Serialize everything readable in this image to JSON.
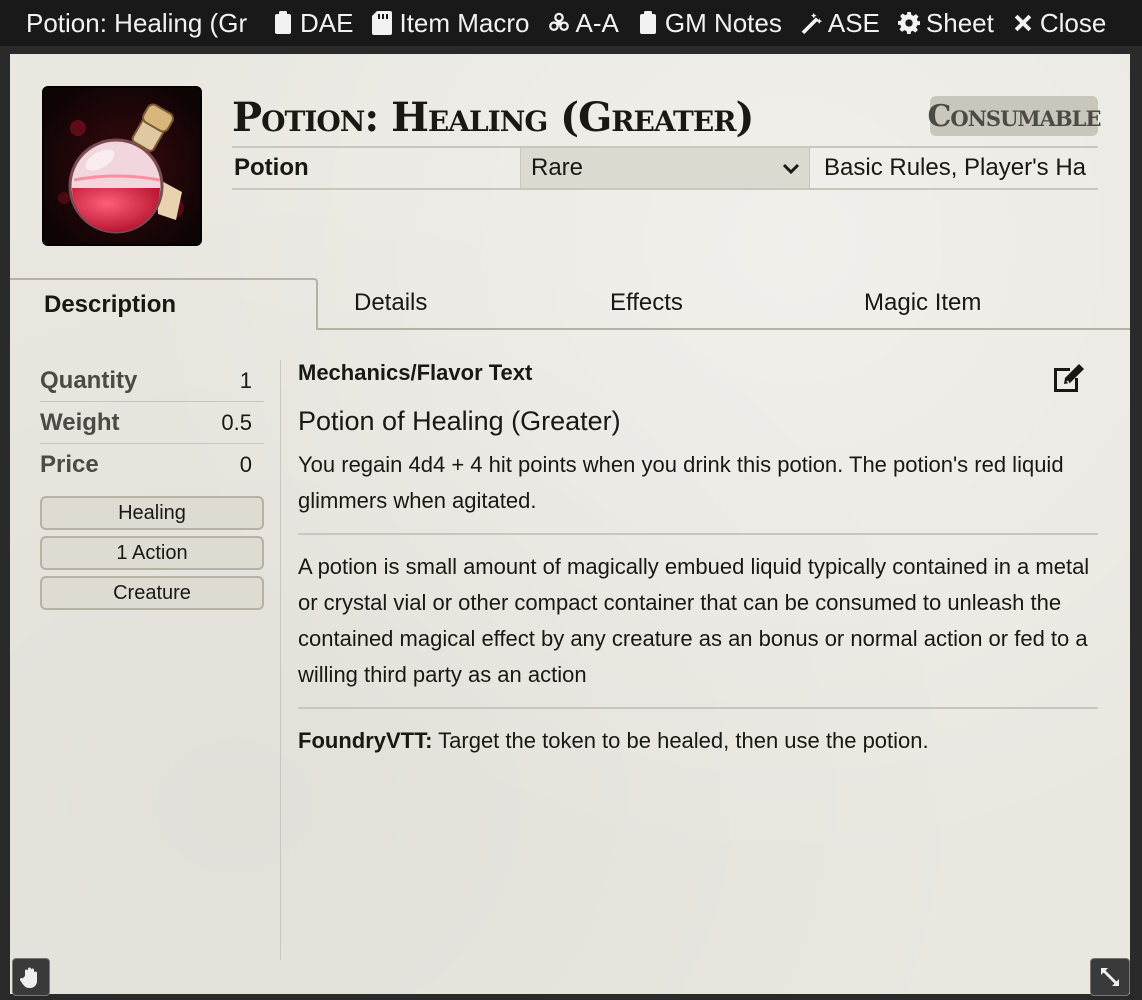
{
  "window": {
    "title": "Potion: Healing (Gr",
    "header_buttons": [
      {
        "label": "DAE",
        "icon": "clipboard-icon"
      },
      {
        "label": "Item Macro",
        "icon": "sd-card-icon"
      },
      {
        "label": "A-A",
        "icon": "biohazard-icon"
      },
      {
        "label": "GM Notes",
        "icon": "clipboard-icon"
      },
      {
        "label": "ASE",
        "icon": "magic-wand-icon"
      },
      {
        "label": "Sheet",
        "icon": "gear-icon"
      },
      {
        "label": "Close",
        "icon": "close-icon"
      }
    ]
  },
  "item": {
    "name": "Potion: Healing (Greater)",
    "type_badge": "Consumable",
    "subtype": "Potion",
    "rarity": "Rare",
    "source": "Basic Rules, Player's Ha"
  },
  "tabs": [
    {
      "label": "Description",
      "active": true
    },
    {
      "label": "Details",
      "active": false
    },
    {
      "label": "Effects",
      "active": false
    },
    {
      "label": "Magic Item",
      "active": false
    }
  ],
  "properties": [
    {
      "label": "Quantity",
      "value": "1"
    },
    {
      "label": "Weight",
      "value": "0.5"
    },
    {
      "label": "Price",
      "value": "0"
    }
  ],
  "tags": [
    "Healing",
    "1 Action",
    "Creature"
  ],
  "description": {
    "heading": "Mechanics/Flavor Text",
    "title": "Potion of Healing (Greater)",
    "para1": "You regain 4d4 + 4 hit points when you drink this potion. The potion's red liquid glimmers when agitated.",
    "para2": "A potion is small amount of magically embued liquid typically contained in a metal or crystal vial or other compact container that can be consumed to unleash the contained magical effect by any creature as an bonus or normal action or fed to a willing third party as an action",
    "note_label": "FoundryVTT:",
    "note_text": " Target the token to be healed, then use the potion."
  },
  "colors": {
    "titlebar": "#191919",
    "parchment": "#e9e7e0",
    "text": "#191813",
    "potion_red": "#d9223c"
  }
}
